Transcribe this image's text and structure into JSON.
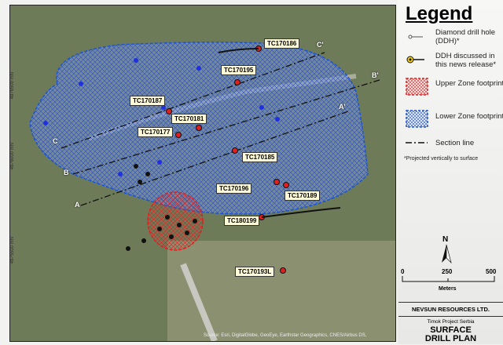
{
  "map": {
    "northings": [
      "4876500 mN",
      "4876000 mN",
      "4875500 mN"
    ],
    "drill_holes": [
      "TC170186",
      "TC170195",
      "TC170187",
      "TC170181",
      "TC170177",
      "TC170185",
      "TC170196",
      "TC170189",
      "TC180199",
      "TC170193L"
    ],
    "sections": [
      "A",
      "A'",
      "B",
      "B'",
      "C",
      "C'"
    ],
    "source": "Source: Esri, DigitalGlobe, GeoEye, Earthstar Geographics, CNES/Airbus DS,"
  },
  "legend": {
    "title": "Legend",
    "items": [
      {
        "label": "Diamond drill hole (DDH)*"
      },
      {
        "label": "DDH discussed in this news release*"
      },
      {
        "label": "Upper Zone footprint"
      },
      {
        "label": "Lower Zone footprint"
      },
      {
        "label": "Section line"
      }
    ],
    "note": "*Projected vertically to surface"
  },
  "scale": {
    "north": "N",
    "ticks": [
      "0",
      "250",
      "500"
    ],
    "unit": "Meters"
  },
  "title_block": {
    "company": "NEVSUN RESOURCES LTD.",
    "project": "Timok Project Serbia",
    "title": "SURFACE DRILL PLAN"
  },
  "colors": {
    "upper": "#e02020",
    "lower": "#1a55d8",
    "hole": "#f5d000"
  }
}
